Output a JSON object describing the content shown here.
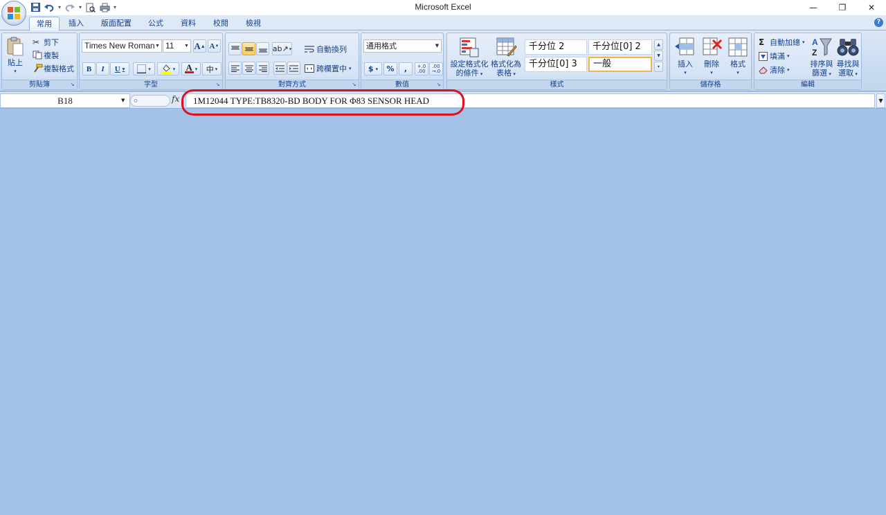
{
  "window": {
    "title": "Microsoft Excel",
    "controls": {
      "minimize": "—",
      "restore": "❐",
      "close": "✕"
    }
  },
  "quick_access": {
    "save": "save-icon",
    "undo": "undo-icon",
    "redo": "redo-icon",
    "print_preview": "print-preview-icon",
    "print": "print-icon",
    "customize": "▾"
  },
  "tabs": [
    "常用",
    "插入",
    "版面配置",
    "公式",
    "資料",
    "校閱",
    "檢視"
  ],
  "active_tab": "常用",
  "ribbon": {
    "clipboard": {
      "label": "剪貼簿",
      "paste": "貼上",
      "cut": "剪下",
      "copy": "複製",
      "format_painter": "複製格式"
    },
    "font": {
      "label": "字型",
      "font_name": "Times New Roman",
      "font_size": "11",
      "grow": "A",
      "shrink": "A",
      "bold": "B",
      "italic": "I",
      "underline": "U",
      "font_color_glyph": "A",
      "phonetic": "中"
    },
    "alignment": {
      "label": "對齊方式",
      "wrap_text": "自動換列",
      "merge_center": "跨欄置中"
    },
    "number": {
      "label": "數值",
      "format": "通用格式",
      "currency": "$",
      "percent": "%",
      "comma": ",",
      "inc_decimal": "+.0\n.00",
      "dec_decimal": ".00\n→.0"
    },
    "styles": {
      "label": "樣式",
      "conditional": [
        "設定格式化",
        "的條件"
      ],
      "as_table": [
        "格式化為",
        "表格"
      ],
      "cells": [
        "千分位 2",
        "千分位[0] 2",
        "千分位[0] 3",
        "一般"
      ],
      "selected_cell": "一般"
    },
    "cells": {
      "label": "儲存格",
      "insert": "插入",
      "delete": "刪除",
      "format": "格式"
    },
    "editing": {
      "label": "編輯",
      "autosum": "自動加總",
      "fill": "填滿",
      "clear": "清除",
      "sort_filter": [
        "排序與",
        "篩選"
      ],
      "find_select": [
        "尋找與",
        "選取"
      ]
    }
  },
  "formula_bar": {
    "name_box": "B18",
    "fx": "fx",
    "content": "1M12044 TYPE:TB8320-BD BODY FOR Φ83 SENSOR HEAD"
  },
  "colors": {
    "workspace": "#a4c2e8",
    "highlight": "#e0101d",
    "ribbon": "#dbe7f6"
  }
}
